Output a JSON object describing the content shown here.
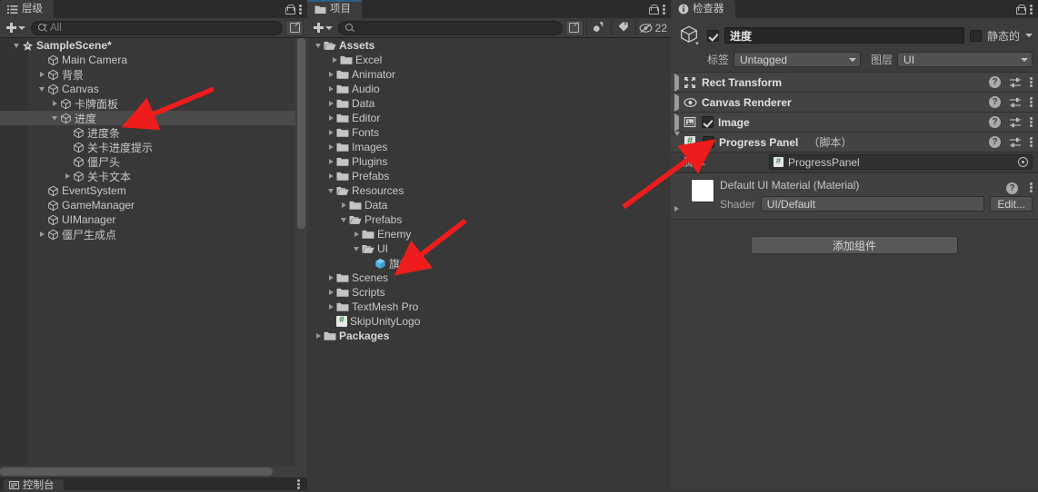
{
  "hierarchy": {
    "tab_label": "层级",
    "tab_icon": "hierarchy-icon",
    "search_placeholder": "All",
    "rows": [
      {
        "label": "SampleScene*",
        "depth": 0,
        "fold": "down",
        "icon": "scene-icon",
        "bold": true,
        "selected": false,
        "kebab": true
      },
      {
        "label": "Main Camera",
        "depth": 2,
        "fold": "none",
        "icon": "gameobject-icon",
        "bold": false,
        "selected": false
      },
      {
        "label": "背景",
        "depth": 2,
        "fold": "right",
        "icon": "gameobject-icon",
        "bold": false,
        "selected": false
      },
      {
        "label": "Canvas",
        "depth": 2,
        "fold": "down",
        "icon": "gameobject-icon",
        "bold": false,
        "selected": false
      },
      {
        "label": "卡牌面板",
        "depth": 3,
        "fold": "right",
        "icon": "gameobject-icon",
        "bold": false,
        "selected": false
      },
      {
        "label": "进度",
        "depth": 3,
        "fold": "down",
        "icon": "gameobject-icon",
        "bold": false,
        "selected": true
      },
      {
        "label": "进度条",
        "depth": 4,
        "fold": "none",
        "icon": "gameobject-icon",
        "bold": false,
        "selected": false
      },
      {
        "label": "关卡进度提示",
        "depth": 4,
        "fold": "none",
        "icon": "gameobject-icon",
        "bold": false,
        "selected": false
      },
      {
        "label": "僵尸头",
        "depth": 4,
        "fold": "none",
        "icon": "gameobject-icon",
        "bold": false,
        "selected": false
      },
      {
        "label": "关卡文本",
        "depth": 4,
        "fold": "right",
        "icon": "gameobject-icon",
        "bold": false,
        "selected": false
      },
      {
        "label": "EventSystem",
        "depth": 2,
        "fold": "none",
        "icon": "gameobject-icon",
        "bold": false,
        "selected": false
      },
      {
        "label": "GameManager",
        "depth": 2,
        "fold": "none",
        "icon": "gameobject-icon",
        "bold": false,
        "selected": false
      },
      {
        "label": "UIManager",
        "depth": 2,
        "fold": "none",
        "icon": "gameobject-icon",
        "bold": false,
        "selected": false
      },
      {
        "label": "僵尸生成点",
        "depth": 2,
        "fold": "right",
        "icon": "gameobject-icon",
        "bold": false,
        "selected": false
      }
    ]
  },
  "project": {
    "tab_label": "项目",
    "tab_icon": "folder-icon",
    "search_placeholder": "",
    "hidden_count": "22",
    "rows": [
      {
        "label": "Assets",
        "depth": 0,
        "fold": "down",
        "icon": "folder-open-icon",
        "bold": true
      },
      {
        "label": "Excel",
        "depth": 1,
        "fold": "right",
        "icon": "folder-icon",
        "bold": false,
        "extra_indent": true
      },
      {
        "label": "Animator",
        "depth": 1,
        "fold": "right",
        "icon": "folder-icon",
        "bold": false
      },
      {
        "label": "Audio",
        "depth": 1,
        "fold": "right",
        "icon": "folder-icon",
        "bold": false
      },
      {
        "label": "Data",
        "depth": 1,
        "fold": "right",
        "icon": "folder-icon",
        "bold": false
      },
      {
        "label": "Editor",
        "depth": 1,
        "fold": "right",
        "icon": "folder-icon",
        "bold": false
      },
      {
        "label": "Fonts",
        "depth": 1,
        "fold": "right",
        "icon": "folder-icon",
        "bold": false
      },
      {
        "label": "Images",
        "depth": 1,
        "fold": "right",
        "icon": "folder-icon",
        "bold": false
      },
      {
        "label": "Plugins",
        "depth": 1,
        "fold": "right",
        "icon": "folder-icon",
        "bold": false
      },
      {
        "label": "Prefabs",
        "depth": 1,
        "fold": "right",
        "icon": "folder-icon",
        "bold": false
      },
      {
        "label": "Resources",
        "depth": 1,
        "fold": "down",
        "icon": "folder-open-icon",
        "bold": false
      },
      {
        "label": "Data",
        "depth": 2,
        "fold": "right",
        "icon": "folder-icon",
        "bold": false
      },
      {
        "label": "Prefabs",
        "depth": 2,
        "fold": "down",
        "icon": "folder-open-icon",
        "bold": false
      },
      {
        "label": "Enemy",
        "depth": 3,
        "fold": "right",
        "icon": "folder-icon",
        "bold": false
      },
      {
        "label": "UI",
        "depth": 3,
        "fold": "down",
        "icon": "folder-open-icon",
        "bold": false
      },
      {
        "label": "旗帜",
        "depth": 4,
        "fold": "none",
        "icon": "prefab-icon",
        "bold": false
      },
      {
        "label": "Scenes",
        "depth": 1,
        "fold": "right",
        "icon": "folder-icon",
        "bold": false
      },
      {
        "label": "Scripts",
        "depth": 1,
        "fold": "right",
        "icon": "folder-icon",
        "bold": false
      },
      {
        "label": "TextMesh Pro",
        "depth": 1,
        "fold": "right",
        "icon": "folder-icon",
        "bold": false
      },
      {
        "label": "SkipUnityLogo",
        "depth": 1,
        "fold": "none",
        "icon": "script-icon",
        "bold": false
      },
      {
        "label": "Packages",
        "depth": 0,
        "fold": "right",
        "icon": "folder-icon",
        "bold": true
      }
    ]
  },
  "inspector": {
    "tab_label": "检查器",
    "tab_icon": "info-icon",
    "object_name": "进度",
    "enabled": true,
    "static_label": "静态的",
    "tag_label": "标签",
    "tag_value": "Untagged",
    "layer_label": "图层",
    "layer_value": "UI",
    "components": [
      {
        "name": "Rect Transform",
        "suffix": "",
        "icon": "rect-transform-icon",
        "fold": "right",
        "has_checkbox": false
      },
      {
        "name": "Canvas Renderer",
        "suffix": "",
        "icon": "eye-icon",
        "fold": "right",
        "has_checkbox": false
      },
      {
        "name": "Image",
        "suffix": "",
        "icon": "image-icon",
        "fold": "right",
        "has_checkbox": true,
        "checked": true
      },
      {
        "name": "Progress Panel",
        "suffix": "（脚本）",
        "icon": "script-icon",
        "fold": "down",
        "has_checkbox": true,
        "checked": true
      }
    ],
    "script_property": {
      "label": "脚本",
      "value": "ProgressPanel"
    },
    "material": {
      "title": "Default UI Material (Material)",
      "shader_label": "Shader",
      "shader_value": "UI/Default",
      "edit_label": "Edit..."
    },
    "add_component_label": "添加组件"
  },
  "console": {
    "tab_label": "控制台",
    "tab_icon": "console-icon"
  },
  "colors": {
    "panel_bg": "#383838",
    "header_bg": "#3c3c3c",
    "tabbar_bg": "#2b2b2b",
    "selected_row": "#4a4a4a",
    "accent_focus": "#2c5d87",
    "annotation_arrow": "#ee1c1c",
    "prefab_blue": "#4bb3e8",
    "script_green": "#2f8b3d"
  },
  "annotations": [
    {
      "name": "arrow-to-progress-node",
      "color": "#ee1c1c"
    },
    {
      "name": "arrow-to-progress-panel-component",
      "color": "#ee1c1c"
    },
    {
      "name": "arrow-to-flag-prefab",
      "color": "#ee1c1c"
    }
  ]
}
